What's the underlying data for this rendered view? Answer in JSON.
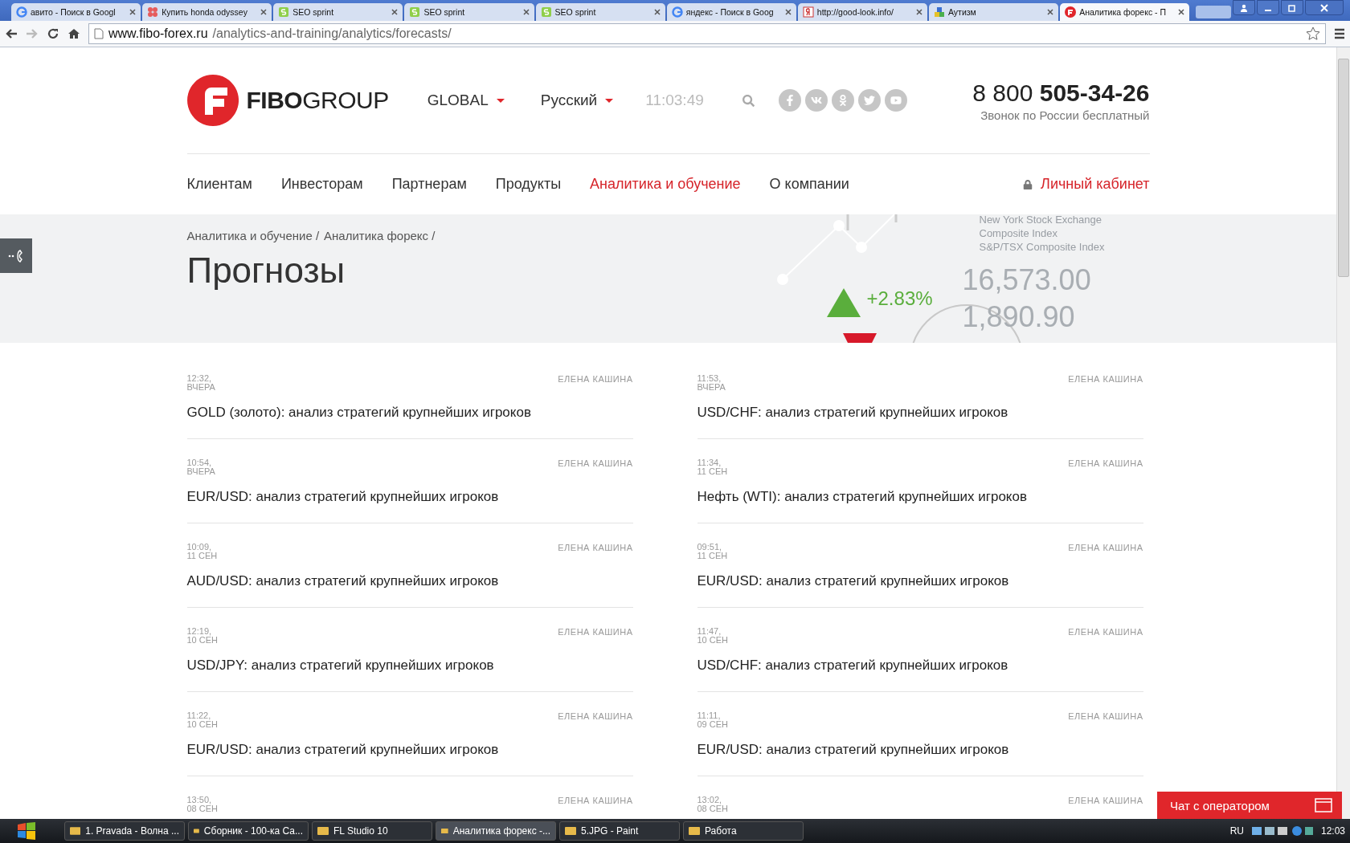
{
  "browser": {
    "tabs": [
      {
        "title": "авито - Поиск в Googl",
        "kind": "google",
        "selected": false
      },
      {
        "title": "Купить honda odyssey",
        "kind": "dots",
        "selected": false
      },
      {
        "title": "SEO sprint",
        "kind": "seo",
        "selected": false
      },
      {
        "title": "SEO sprint",
        "kind": "seo",
        "selected": false
      },
      {
        "title": "SEO sprint",
        "kind": "seo",
        "selected": false
      },
      {
        "title": "яндекс - Поиск в Goog",
        "kind": "google",
        "selected": false
      },
      {
        "title": "http://good-look.info/",
        "kind": "yandex",
        "selected": false
      },
      {
        "title": "Аутизм",
        "kind": "blocks",
        "selected": false
      },
      {
        "title": "Аналитика форекс - П",
        "kind": "fibo",
        "selected": true
      }
    ],
    "url": {
      "domain": "www.fibo-forex.ru",
      "path": "/analytics-and-training/analytics/forecasts/"
    }
  },
  "header": {
    "logo": {
      "bold": "FIBO",
      "light": "GROUP"
    },
    "region": "GLOBAL",
    "language": "Русский",
    "time": "11:03:49",
    "phone": {
      "prefix": "8 800",
      "number": "505-34-26",
      "note": "Звонок по России бесплатный"
    },
    "nav": [
      {
        "label": "Клиентам",
        "selected": false
      },
      {
        "label": "Инвесторам",
        "selected": false
      },
      {
        "label": "Партнерам",
        "selected": false
      },
      {
        "label": "Продукты",
        "selected": false
      },
      {
        "label": "Аналитика и обучение",
        "selected": true
      },
      {
        "label": "О компании",
        "selected": false
      }
    ],
    "cabinet": "Личный кабинет"
  },
  "hero": {
    "breadcrumbs": [
      "Аналитика и обучение /",
      "Аналитика форекс /"
    ],
    "title": "Прогнозы",
    "index_names": [
      "New York Stock Exchange",
      "Composite Index",
      "S&P/TSX Composite Index"
    ],
    "values": [
      "16,573.00",
      "1,890.90"
    ],
    "change": "+2.83%"
  },
  "articles": [
    [
      {
        "time": "12:32,",
        "date": "ВЧЕРА",
        "author": "ЕЛЕНА КАШИНА",
        "title": "GOLD (золото): анализ стратегий крупнейших игроков"
      },
      {
        "time": "10:54,",
        "date": "ВЧЕРА",
        "author": "ЕЛЕНА КАШИНА",
        "title": "EUR/USD: анализ стратегий крупнейших игроков"
      },
      {
        "time": "10:09,",
        "date": "11 СЕН",
        "author": "ЕЛЕНА КАШИНА",
        "title": "AUD/USD: анализ стратегий крупнейших игроков"
      },
      {
        "time": "12:19,",
        "date": "10 СЕН",
        "author": "ЕЛЕНА КАШИНА",
        "title": "USD/JPY: анализ стратегий крупнейших игроков"
      },
      {
        "time": "11:22,",
        "date": "10 СЕН",
        "author": "ЕЛЕНА КАШИНА",
        "title": "EUR/USD: анализ стратегий крупнейших игроков"
      },
      {
        "time": "13:50,",
        "date": "08 СЕН",
        "author": "ЕЛЕНА КАШИНА"
      }
    ],
    [
      {
        "time": "11:53,",
        "date": "ВЧЕРА",
        "author": "ЕЛЕНА КАШИНА",
        "title": "USD/CHF: анализ стратегий крупнейших игроков"
      },
      {
        "time": "11:34,",
        "date": "11 СЕН",
        "author": "ЕЛЕНА КАШИНА",
        "title": "Нефть (WTI): анализ стратегий крупнейших игроков"
      },
      {
        "time": "09:51,",
        "date": "11 СЕН",
        "author": "ЕЛЕНА КАШИНА",
        "title": "EUR/USD: анализ стратегий крупнейших игроков"
      },
      {
        "time": "11:47,",
        "date": "10 СЕН",
        "author": "ЕЛЕНА КАШИНА",
        "title": "USD/CHF: анализ стратегий крупнейших игроков"
      },
      {
        "time": "11:11,",
        "date": "09 СЕН",
        "author": "ЕЛЕНА КАШИНА",
        "title": "EUR/USD: анализ стратегий крупнейших игроков"
      },
      {
        "time": "13:02,",
        "date": "08 СЕН",
        "author": "ЕЛЕНА КАШИНА"
      }
    ]
  ],
  "chat": {
    "label": "Чат с оператором"
  },
  "taskbar": {
    "items": [
      {
        "label": "1. Pravada  -  Волна ...",
        "selected": false
      },
      {
        "label": "Сборник - 100-ка Са...",
        "selected": false
      },
      {
        "label": "FL Studio 10",
        "selected": false
      },
      {
        "label": "Аналитика форекс -...",
        "selected": true
      },
      {
        "label": "5.JPG - Paint",
        "selected": false
      },
      {
        "label": "Работа",
        "selected": false
      }
    ],
    "language": "RU",
    "clock": "12:03"
  }
}
